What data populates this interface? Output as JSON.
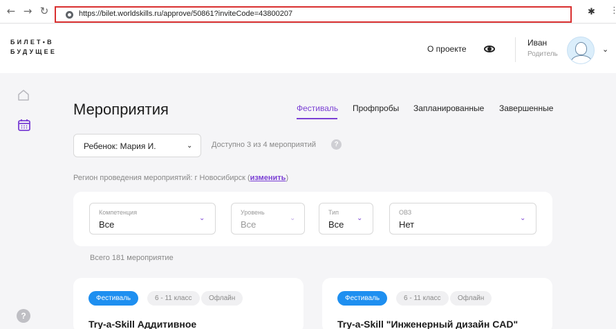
{
  "browser": {
    "url": "https://bilet.worldskills.ru/approve/50861?inviteCode=43800207"
  },
  "header": {
    "logo_line1": "БИЛЕТ•В",
    "logo_line2": "БУДУЩЕЕ",
    "about": "О проекте",
    "user_name": "Иван",
    "user_role": "Родитель"
  },
  "page": {
    "title": "Мероприятия",
    "tabs": [
      {
        "label": "Фестиваль",
        "active": true
      },
      {
        "label": "Профпробы",
        "active": false
      },
      {
        "label": "Запланированные",
        "active": false
      },
      {
        "label": "Завершенные",
        "active": false
      }
    ],
    "child_select": "Ребенок: Мария И.",
    "available": "Доступно 3 из 4 мероприятий",
    "region_prefix": "Регион проведения мероприятий: г Новосибирск (",
    "region_change": "изменить",
    "region_suffix": ")",
    "help_char": "?"
  },
  "filters": [
    {
      "label": "Компетенция",
      "value": "Все",
      "disabled": false
    },
    {
      "label": "Уровень",
      "value": "Все",
      "disabled": true
    },
    {
      "label": "Тип",
      "value": "Все",
      "disabled": false
    },
    {
      "label": "ОВЗ",
      "value": "Нет",
      "disabled": false
    }
  ],
  "total": "Всего 181 мероприятие",
  "cards": [
    {
      "badges": [
        "Фестиваль",
        "6 - 11 класс",
        "Офлайн"
      ],
      "title": "Try-a-Skill Аддитивное"
    },
    {
      "badges": [
        "Фестиваль",
        "6 - 11 класс",
        "Офлайн"
      ],
      "title": "Try-a-Skill \"Инженерный дизайн CAD\""
    }
  ],
  "colors": {
    "accent": "#7a3fd4",
    "badge_blue": "#1e8ff0",
    "highlight": "#d93030"
  }
}
